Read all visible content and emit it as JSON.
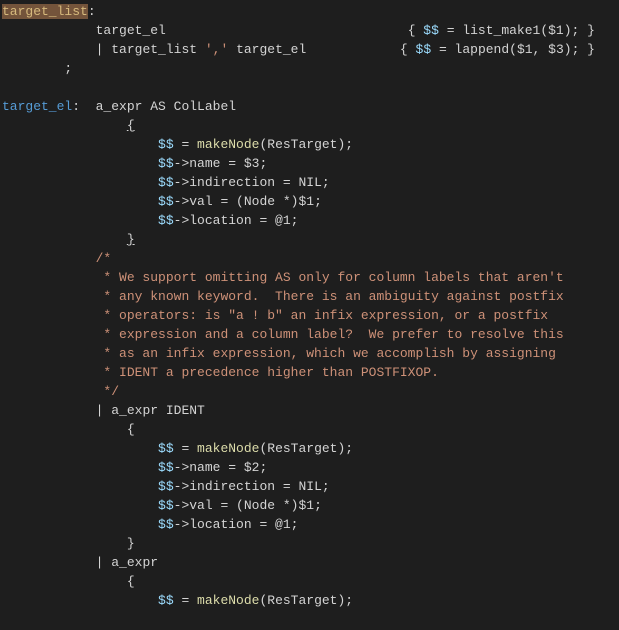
{
  "rule1": {
    "name": "target_list",
    "colon": ":",
    "alt1_lhs": "target_el",
    "alt1_action_open": "{ ",
    "alt1_dd": "$$",
    "alt1_eq": " = ",
    "alt1_fn": "list_make1",
    "alt1_args": "($1); ",
    "alt1_close": "}",
    "alt2_pipe": "| ",
    "alt2_left": "target_list",
    "alt2_comma": " ',' ",
    "alt2_right": "target_el",
    "alt2_action_open": "{ ",
    "alt2_dd": "$$",
    "alt2_eq": " = ",
    "alt2_fn": "lappend",
    "alt2_args": "($1, $3); ",
    "alt2_close": "}",
    "semi": ";"
  },
  "rule2": {
    "name": "target_el",
    "colon": ":  ",
    "head": "a_expr AS ColLabel",
    "b_open": "{",
    "s1a": "$$",
    "s1b": " = ",
    "s1c": "makeNode",
    "s1d": "(ResTarget);",
    "s2a": "$$",
    "s2b": "->name = $3;",
    "s3a": "$$",
    "s3b": "->indirection = NIL;",
    "s4a": "$$",
    "s4b": "->val = (Node *)$1;",
    "s5a": "$$",
    "s5b": "->location = @1;",
    "b_close": "}",
    "c0": "/*",
    "c1": " * We support omitting AS only for column labels that aren't",
    "c2": " * any known keyword.  There is an ambiguity against postfix",
    "c3": " * operators: is \"a ! b\" an infix expression, or a postfix",
    "c4": " * expression and a column label?  We prefer to resolve this",
    "c5": " * as an infix expression, which we accomplish by assigning",
    "c6": " * IDENT a precedence higher than POSTFIXOP.",
    "c7": " */",
    "alt2_pipe": "| ",
    "alt2_head": "a_expr IDENT",
    "alt2_open": "{",
    "a2s1a": "$$",
    "a2s1b": " = ",
    "a2s1c": "makeNode",
    "a2s1d": "(ResTarget);",
    "a2s2a": "$$",
    "a2s2b": "->name = $2;",
    "a2s3a": "$$",
    "a2s3b": "->indirection = NIL;",
    "a2s4a": "$$",
    "a2s4b": "->val = (Node *)$1;",
    "a2s5a": "$$",
    "a2s5b": "->location = @1;",
    "alt2_close": "}",
    "alt3_pipe": "| ",
    "alt3_head": "a_expr",
    "alt3_open": "{",
    "a3s1a": "$$",
    "a3s1b": " = ",
    "a3s1c": "makeNode",
    "a3s1d": "(ResTarget);"
  }
}
